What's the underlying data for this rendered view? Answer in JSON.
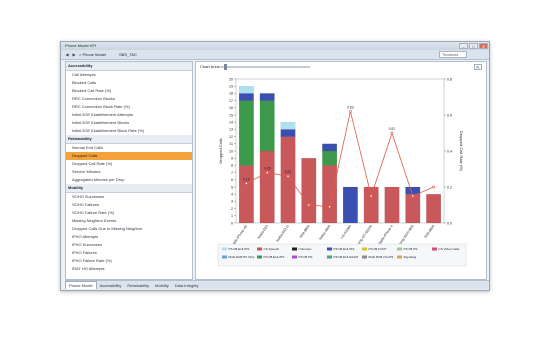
{
  "window": {
    "title": "Phone Model KPI",
    "breadcrumb": "> Phone Model",
    "tab_crumb": "SBS_TAC",
    "threshold_placeholder": "Threshold",
    "minimize": "–",
    "maximize": "□",
    "close": "✕"
  },
  "toolbar": {
    "back": "◀",
    "forward": "▶"
  },
  "sidebar": {
    "sections": [
      {
        "title": "Accessibility",
        "items": [
          "Call Attempts",
          "Blocked Calls",
          "Blocked Call Rate (%)",
          "RRC Connection Blocks",
          "RRC Connection Block Rate (%)",
          "Initial E2E Establishment Attempts",
          "Initial E2E Establishment Blocks",
          "Initial E2E Establishment Block Rate (%)"
        ]
      },
      {
        "title": "Retainability",
        "items": [
          "Normal End Calls",
          "Dropped Calls",
          "Dropped Call Rate (%)",
          "Service Minutes",
          "Aggregated Minutes per Drop"
        ]
      },
      {
        "title": "Mobility",
        "items": [
          "SOHO Successes",
          "SOHO Failures",
          "SOHO Failure Rate (%)",
          "Missing Neighbor Events",
          "Dropped Calls Due to Missing Neighbor",
          "IFHO Attempts",
          "IFHO Successes",
          "IFHO Failures",
          "IFHO Failure Rate (%)",
          "IRAT HO Attempts"
        ]
      }
    ],
    "selected": "Dropped Calls"
  },
  "bottom_tabs": [
    "Phone Model",
    "Accessibility",
    "Retainability",
    "Mobility",
    "Data Integrity"
  ],
  "chart_panel": {
    "slider_label": "Chart Area:",
    "corner_button": "⇱"
  },
  "colors": {
    "accent": "#f4a23a",
    "red": "#c8585a",
    "green": "#3d9a4c",
    "blue": "#3b4fb0",
    "light_blue": "#aee0ef",
    "line": "#e15a4d"
  },
  "chart_data": {
    "type": "bar",
    "stacked": true,
    "categories": [
      "Apple-iPhone 4S",
      "Nokia-E63",
      "Nokia-E63 G",
      "RIM-8900",
      "Nokia-5800",
      "LG-KS360",
      "Samsung-GT-S5230",
      "Apple-iPhone 4",
      "Samsung-SGH-i900",
      "RIM-9800"
    ],
    "ylabel": "Dropped Calls",
    "y2label": "Dropped Call Rate (%)",
    "ylim": [
      0,
      20
    ],
    "y2lim": [
      0,
      0.8
    ],
    "y_ticks": [
      "0",
      "1",
      "2",
      "3",
      "4",
      "5",
      "6",
      "7",
      "8",
      "9",
      "10",
      "11",
      "12",
      "13",
      "14",
      "15",
      "16",
      "17",
      "18",
      "19",
      "20"
    ],
    "y2_ticks": [
      "0.0",
      "0.2",
      "0.4",
      "0.6",
      "0.8"
    ],
    "series": [
      {
        "name": "CS Speech",
        "color": "#c8585a",
        "values": [
          8,
          10,
          12,
          9,
          8,
          0,
          5,
          5,
          4,
          4
        ]
      },
      {
        "name": "PS I/B RAB",
        "color": "#3d9a4c",
        "values": [
          9,
          7,
          0,
          0,
          2,
          0,
          0,
          0,
          0,
          0
        ]
      },
      {
        "name": "PS I/B EUL/HS",
        "color": "#3b4fb0",
        "values": [
          1,
          1,
          1,
          0,
          1,
          5,
          0,
          0,
          1,
          0
        ]
      },
      {
        "name": "PS I/B HS",
        "color": "#aee0ef",
        "values": [
          1,
          0,
          1,
          0,
          0,
          0,
          0,
          0,
          0,
          0
        ]
      }
    ],
    "bar_labels": [
      "",
      "",
      "",
      "",
      "",
      "",
      "",
      "",
      "",
      ""
    ],
    "line": {
      "name": "Dropped Call Rate (%)",
      "color": "#e15a4d",
      "values": [
        0.22,
        0.28,
        0.26,
        0.1,
        0.09,
        0.62,
        0.15,
        0.5,
        0.15,
        0.2
      ]
    },
    "point_labels": [
      "0.18",
      "0.26",
      "0.22",
      "",
      "",
      "0.63",
      "",
      "0.57",
      "",
      ""
    ],
    "legend": [
      "PS I/B EUL/HS",
      "CS Speech",
      "Unknown",
      "PS I/B EUL/HS",
      "PS I/B FACH",
      "PS I/B HS",
      "CS Video Calls",
      "Multi RAB PS Only",
      "PS I/B EUL/HS",
      "PS I/B HS",
      "PS I/B EUL/FACH",
      "Multi RAB CS+PS",
      "Signaling"
    ],
    "legend_colors": [
      "#aee0ef",
      "#c8585a",
      "#222222",
      "#3b4fb0",
      "#d8c52c",
      "#9ecf7c",
      "#d94a7a",
      "#6aa0d8",
      "#3d9a4c",
      "#b64ad6",
      "#4f9c9c",
      "#8a8a8a",
      "#e0a050"
    ]
  }
}
